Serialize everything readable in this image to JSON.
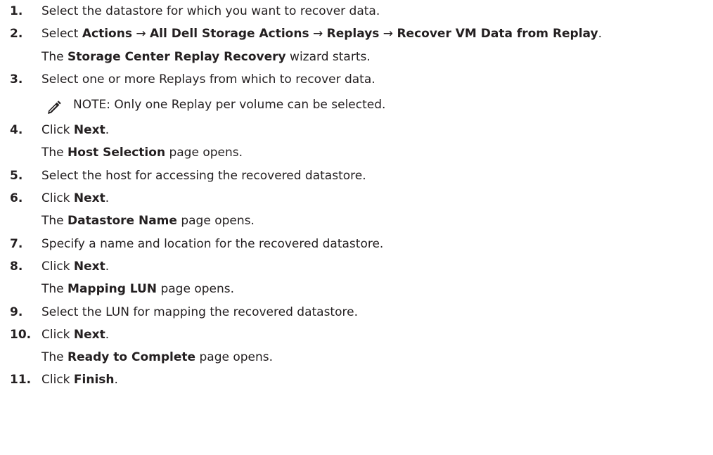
{
  "steps": [
    {
      "type": "step",
      "number": "1.",
      "parts": [
        {
          "text": "Select the datastore for which you want to recover data.",
          "bold": false
        }
      ]
    },
    {
      "type": "step",
      "number": "2.",
      "parts": [
        {
          "text": "Select ",
          "bold": false
        },
        {
          "text": "Actions",
          "bold": true
        },
        {
          "text": " → ",
          "bold": false
        },
        {
          "text": "All Dell Storage Actions",
          "bold": true
        },
        {
          "text": " → ",
          "bold": false
        },
        {
          "text": "Replays",
          "bold": true
        },
        {
          "text": " → ",
          "bold": false
        },
        {
          "text": "Recover VM Data from Replay",
          "bold": true
        },
        {
          "text": ".",
          "bold": false
        }
      ]
    },
    {
      "type": "result",
      "parts": [
        {
          "text": "The ",
          "bold": false
        },
        {
          "text": "Storage Center Replay Recovery",
          "bold": true
        },
        {
          "text": " wizard starts.",
          "bold": false
        }
      ]
    },
    {
      "type": "step",
      "number": "3.",
      "parts": [
        {
          "text": "Select one or more Replays from which to recover data.",
          "bold": false
        }
      ]
    },
    {
      "type": "note",
      "label": "NOTE:",
      "text": " Only one Replay per volume can be selected."
    },
    {
      "type": "step",
      "number": "4.",
      "parts": [
        {
          "text": "Click ",
          "bold": false
        },
        {
          "text": "Next",
          "bold": true
        },
        {
          "text": ".",
          "bold": false
        }
      ]
    },
    {
      "type": "result",
      "parts": [
        {
          "text": "The ",
          "bold": false
        },
        {
          "text": "Host Selection",
          "bold": true
        },
        {
          "text": " page opens.",
          "bold": false
        }
      ]
    },
    {
      "type": "step",
      "number": "5.",
      "parts": [
        {
          "text": "Select the host for accessing the recovered datastore.",
          "bold": false
        }
      ]
    },
    {
      "type": "step",
      "number": "6.",
      "parts": [
        {
          "text": "Click ",
          "bold": false
        },
        {
          "text": "Next",
          "bold": true
        },
        {
          "text": ".",
          "bold": false
        }
      ]
    },
    {
      "type": "result",
      "parts": [
        {
          "text": "The ",
          "bold": false
        },
        {
          "text": "Datastore Name",
          "bold": true
        },
        {
          "text": " page opens.",
          "bold": false
        }
      ]
    },
    {
      "type": "step",
      "number": "7.",
      "parts": [
        {
          "text": "Specify a name and location for the recovered datastore.",
          "bold": false
        }
      ]
    },
    {
      "type": "step",
      "number": "8.",
      "parts": [
        {
          "text": "Click ",
          "bold": false
        },
        {
          "text": "Next",
          "bold": true
        },
        {
          "text": ".",
          "bold": false
        }
      ]
    },
    {
      "type": "result",
      "parts": [
        {
          "text": "The ",
          "bold": false
        },
        {
          "text": "Mapping LUN",
          "bold": true
        },
        {
          "text": " page opens.",
          "bold": false
        }
      ]
    },
    {
      "type": "step",
      "number": "9.",
      "parts": [
        {
          "text": "Select the LUN for mapping the recovered datastore.",
          "bold": false
        }
      ]
    },
    {
      "type": "step",
      "number": "10.",
      "parts": [
        {
          "text": "Click ",
          "bold": false
        },
        {
          "text": "Next",
          "bold": true
        },
        {
          "text": ".",
          "bold": false
        }
      ]
    },
    {
      "type": "result",
      "parts": [
        {
          "text": "The ",
          "bold": false
        },
        {
          "text": "Ready to Complete",
          "bold": true
        },
        {
          "text": " page opens.",
          "bold": false
        }
      ]
    },
    {
      "type": "step",
      "number": "11.",
      "parts": [
        {
          "text": "Click ",
          "bold": false
        },
        {
          "text": "Finish",
          "bold": true
        },
        {
          "text": ".",
          "bold": false
        }
      ]
    }
  ],
  "note_icon": "pencil-note-icon",
  "text_color": "#231f20"
}
